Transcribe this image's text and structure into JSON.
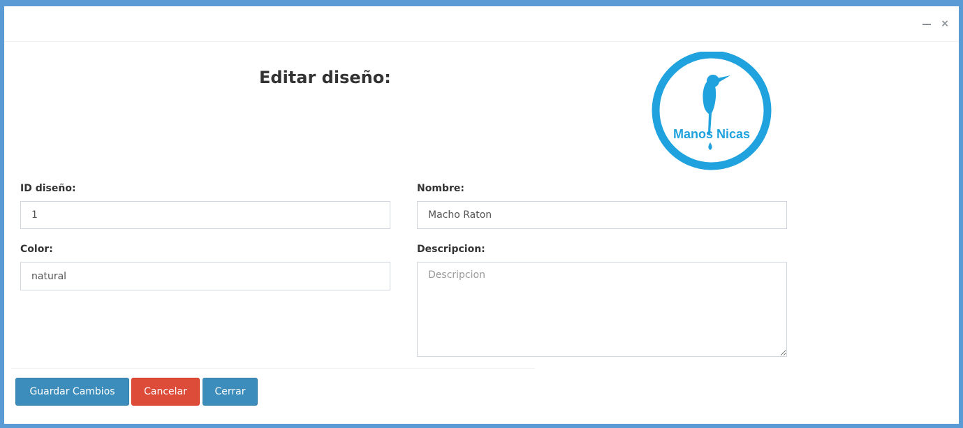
{
  "modal": {
    "title": "Editar diseño:",
    "window_controls": {
      "minimize_icon": "minimize-icon",
      "close_icon": "close-icon",
      "close_glyph": "×"
    }
  },
  "logo": {
    "text": "Manos Nicas",
    "color": "#1fa2dd"
  },
  "form": {
    "id_label": "ID diseño:",
    "id_value": "1",
    "nombre_label": "Nombre:",
    "nombre_value": "Macho Raton",
    "color_label": "Color:",
    "color_value": "natural",
    "descripcion_label": "Descripcion:",
    "descripcion_placeholder": "Descripcion",
    "descripcion_value": ""
  },
  "buttons": {
    "save_label": "Guardar Cambios",
    "cancel_label": "Cancelar",
    "close_label": "Cerrar"
  },
  "colors": {
    "frame_border": "#5b9bd5",
    "primary": "#3c8dbc",
    "danger": "#dd4b39"
  }
}
